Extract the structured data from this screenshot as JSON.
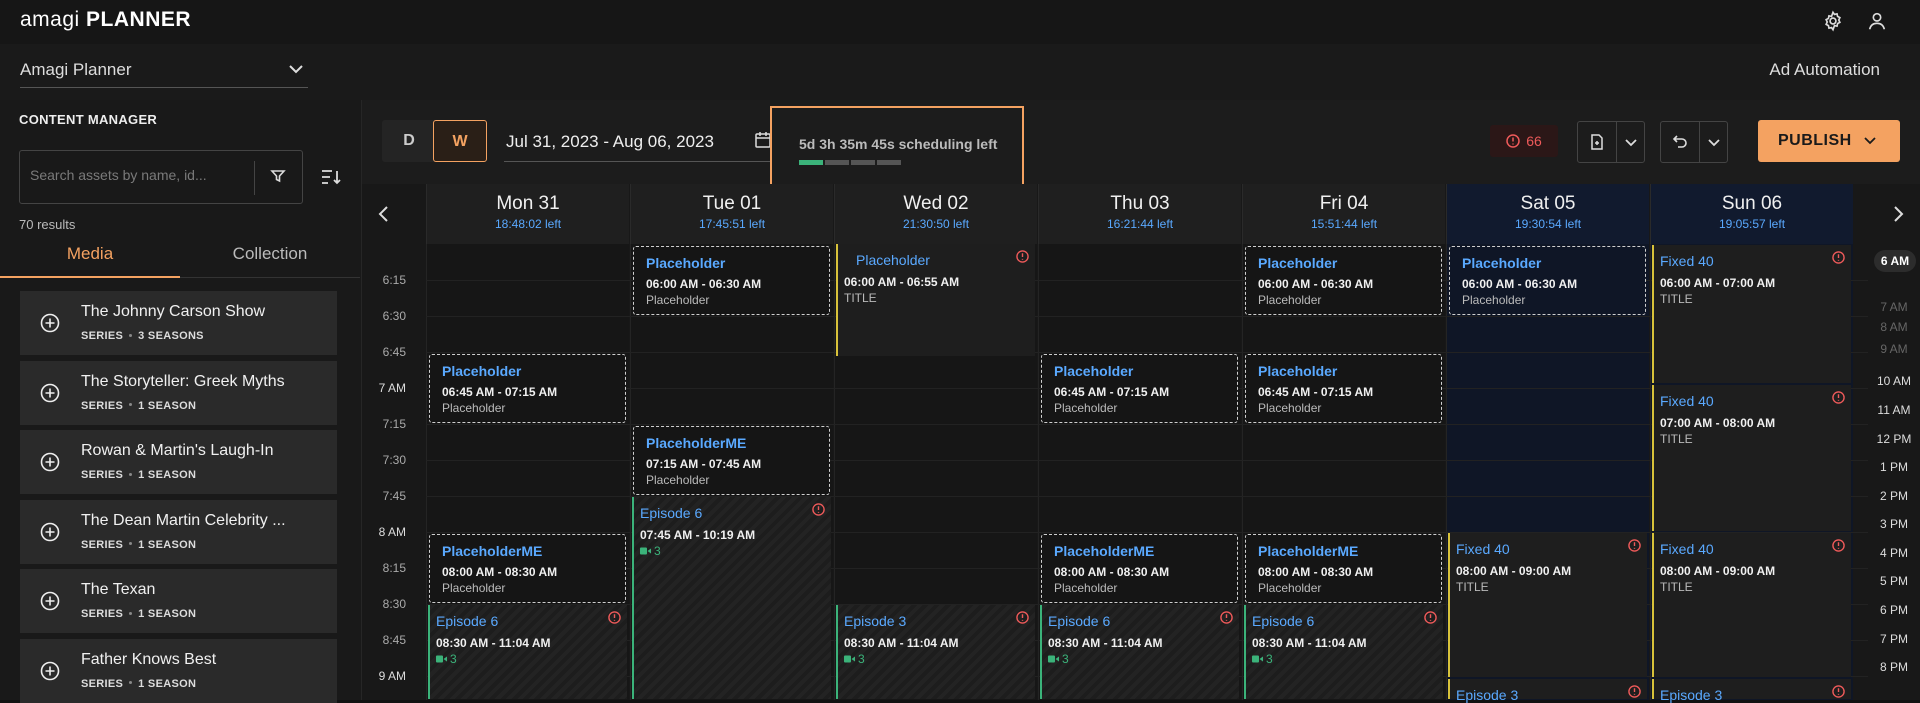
{
  "app": {
    "brand_light": "amagi",
    "brand_bold": "PLANNER"
  },
  "selector": {
    "value": "Amagi Planner"
  },
  "right_title": "Ad Automation",
  "sidebar": {
    "title": "CONTENT MANAGER",
    "search_placeholder": "Search assets by name, id...",
    "results": "70 results",
    "tabs": [
      "Media",
      "Collection"
    ],
    "assets": [
      {
        "name": "The Johnny Carson Show",
        "type": "SERIES",
        "seasons": "3 SEASONS"
      },
      {
        "name": "The Storyteller: Greek Myths",
        "type": "SERIES",
        "seasons": "1 SEASON"
      },
      {
        "name": "Rowan & Martin's Laugh-In",
        "type": "SERIES",
        "seasons": "1 SEASON"
      },
      {
        "name": "The Dean Martin Celebrity ...",
        "type": "SERIES",
        "seasons": "1 SEASON"
      },
      {
        "name": "The Texan",
        "type": "SERIES",
        "seasons": "1 SEASON"
      },
      {
        "name": "Father Knows Best",
        "type": "SERIES",
        "seasons": "1 SEASON"
      }
    ]
  },
  "toolbar": {
    "day_label": "D",
    "week_label": "W",
    "date_range": "Jul 31, 2023 - Aug 06, 2023",
    "schedule_left": "5d 3h 35m 45s scheduling left",
    "schedule_progress_segments": 4,
    "schedule_progress_filled": 1,
    "error_count": "66",
    "publish_label": "PUBLISH"
  },
  "days": [
    {
      "name": "Mon 31",
      "left": "18:48:02 left"
    },
    {
      "name": "Tue 01",
      "left": "17:45:51 left"
    },
    {
      "name": "Wed 02",
      "left": "21:30:50 left"
    },
    {
      "name": "Thu 03",
      "left": "16:21:44 left"
    },
    {
      "name": "Fri 04",
      "left": "15:51:44 left"
    },
    {
      "name": "Sat 05",
      "left": "19:30:54 left"
    },
    {
      "name": "Sun 06",
      "left": "19:05:57 left"
    }
  ],
  "time_labels": [
    "6:15",
    "6:30",
    "6:45",
    "7 AM",
    "7:15",
    "7:30",
    "7:45",
    "8 AM",
    "8:15",
    "8:30",
    "8:45",
    "9 AM"
  ],
  "rail": {
    "current": "6 AM",
    "labels": [
      "7 AM",
      "8 AM",
      "9 AM",
      "10 AM",
      "11 AM",
      "12 PM",
      "1 PM",
      "2 PM",
      "3 PM",
      "4 PM",
      "5 PM",
      "6 PM",
      "7 PM",
      "8 PM"
    ]
  },
  "blocks": {
    "placeholder": "Placeholder",
    "placeholder_me": "PlaceholderME",
    "sub_placeholder": "Placeholder",
    "title": "TITLE",
    "fixed": "Fixed 40",
    "ep6": "Episode 6",
    "ep3": "Episode 3",
    "t0600_0630": "06:00 AM - 06:30 AM",
    "t0600_0655": "06:00 AM - 06:55 AM",
    "t0600_0700": "06:00 AM - 07:00 AM",
    "t0645_0715": "06:45 AM - 07:15 AM",
    "t0700_0800": "07:00 AM - 08:00 AM",
    "t0715_0745": "07:15 AM - 07:45 AM",
    "t0745_1019": "07:45 AM - 10:19 AM",
    "t0800_0830": "08:00 AM - 08:30 AM",
    "t0800_0900": "08:00 AM - 09:00 AM",
    "t0830_1104": "08:30 AM - 11:04 AM",
    "count3": "3"
  },
  "colors": {
    "accent": "#f4a261",
    "link": "#5aa9ff",
    "success": "#3bb37a",
    "error": "#ee5a5a"
  }
}
